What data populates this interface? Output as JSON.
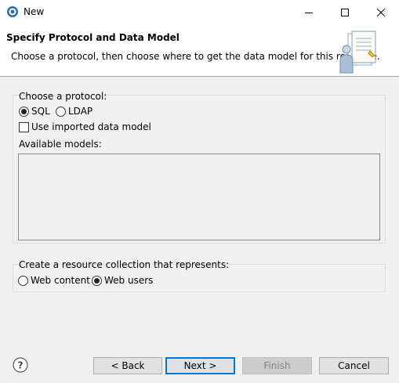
{
  "window": {
    "title": "New",
    "app_icon": "eclipse-icon",
    "controls": [
      "minimize-icon",
      "maximize-icon",
      "close-icon"
    ]
  },
  "header": {
    "title": "Specify Protocol and Data Model",
    "description": "Choose a protocol, then choose where to get the data model for this resource.",
    "graphic": "wizard-person-document-graphic"
  },
  "protocol": {
    "label": "Choose a protocol:",
    "options": [
      {
        "label": "SQL",
        "selected": true
      },
      {
        "label": "LDAP",
        "selected": false
      }
    ]
  },
  "imported": {
    "label": "Use imported data model",
    "checked": false
  },
  "models": {
    "label": "Available models:",
    "items": []
  },
  "collection": {
    "label": "Create a resource collection that represents:",
    "options": [
      {
        "label": "Web content",
        "selected": false
      },
      {
        "label": "Web users",
        "selected": true
      }
    ]
  },
  "buttons": {
    "help_icon": "help-icon",
    "back": "< Back",
    "next": "Next >",
    "finish": "Finish",
    "cancel": "Cancel",
    "finish_enabled": false,
    "default_button": "next"
  }
}
